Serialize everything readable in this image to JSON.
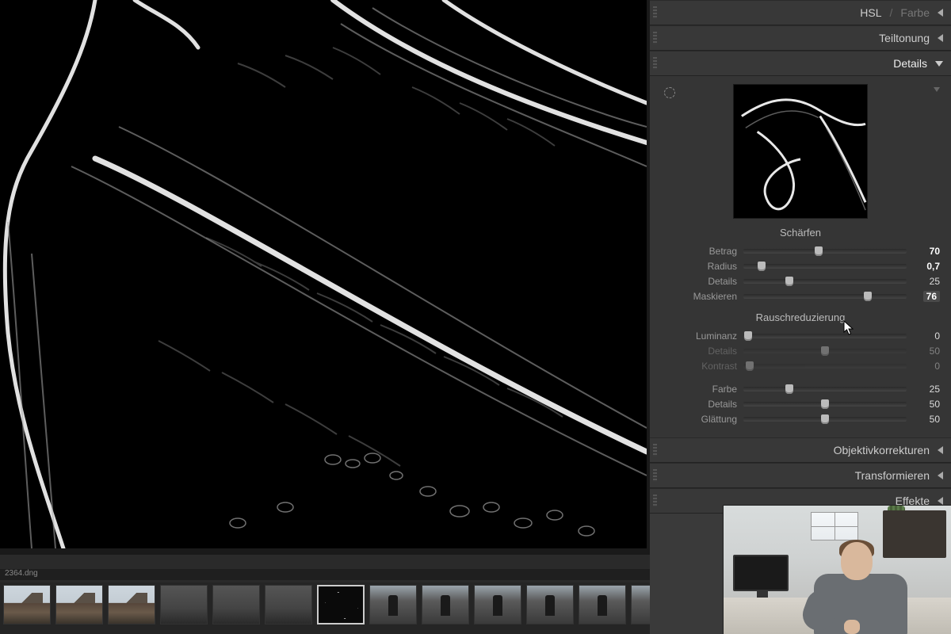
{
  "filename": "2364.dng",
  "panels": {
    "hsl": {
      "label": "HSL",
      "label2": "Farbe"
    },
    "split": {
      "label": "Teiltonung"
    },
    "details": {
      "label": "Details"
    },
    "lens": {
      "label": "Objektivkorrekturen"
    },
    "transform": {
      "label": "Transformieren"
    },
    "effects": {
      "label": "Effekte"
    }
  },
  "sharpen": {
    "title": "Schärfen",
    "amount": {
      "label": "Betrag",
      "value": "70",
      "pct": 46
    },
    "radius": {
      "label": "Radius",
      "value": "0,7",
      "pct": 11
    },
    "detail": {
      "label": "Details",
      "value": "25",
      "pct": 28
    },
    "mask": {
      "label": "Maskieren",
      "value": "76",
      "pct": 76
    }
  },
  "noise": {
    "title": "Rauschreduzierung",
    "luminance": {
      "label": "Luminanz",
      "value": "0",
      "pct": 3
    },
    "ldetail": {
      "label": "Details",
      "value": "50",
      "pct": 50
    },
    "lcontrast": {
      "label": "Kontrast",
      "value": "0",
      "pct": 4
    },
    "color": {
      "label": "Farbe",
      "value": "25",
      "pct": 28
    },
    "cdetail": {
      "label": "Details",
      "value": "50",
      "pct": 50
    },
    "csmooth": {
      "label": "Glättung",
      "value": "50",
      "pct": 50
    }
  },
  "filmstrip": [
    {
      "kind": "mountain"
    },
    {
      "kind": "mountain"
    },
    {
      "kind": "mountain"
    },
    {
      "kind": "dark"
    },
    {
      "kind": "dark"
    },
    {
      "kind": "dark"
    },
    {
      "kind": "mask",
      "active": true
    },
    {
      "kind": "figure"
    },
    {
      "kind": "figure"
    },
    {
      "kind": "figure"
    },
    {
      "kind": "figure"
    },
    {
      "kind": "figure"
    },
    {
      "kind": "figure"
    }
  ]
}
